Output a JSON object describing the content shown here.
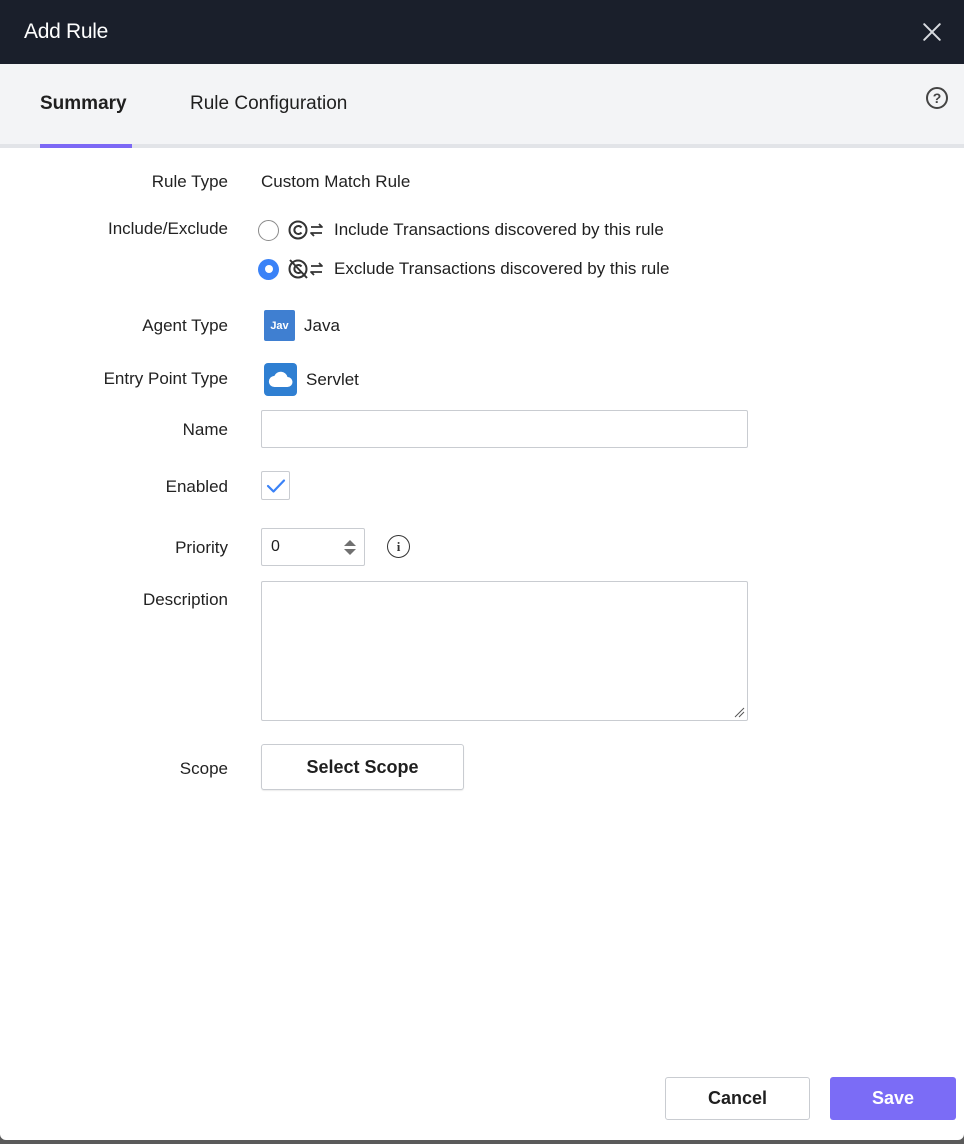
{
  "dialog": {
    "title": "Add Rule"
  },
  "tabs": [
    {
      "label": "Summary",
      "active": true
    },
    {
      "label": "Rule Configuration",
      "active": false
    }
  ],
  "help_icon_glyph": "?",
  "form": {
    "rule_type": {
      "label": "Rule Type",
      "value": "Custom Match Rule"
    },
    "include_exclude": {
      "label": "Include/Exclude",
      "options": [
        {
          "label": "Include Transactions discovered by this rule",
          "checked": false
        },
        {
          "label": "Exclude Transactions discovered by this rule",
          "checked": true
        }
      ]
    },
    "agent_type": {
      "label": "Agent Type",
      "badge": "Jav",
      "value": "Java"
    },
    "entry_point_type": {
      "label": "Entry Point Type",
      "value": "Servlet"
    },
    "name": {
      "label": "Name",
      "value": "",
      "placeholder": ""
    },
    "enabled": {
      "label": "Enabled",
      "checked": true
    },
    "priority": {
      "label": "Priority",
      "value": "0"
    },
    "info_glyph": "i",
    "description": {
      "label": "Description",
      "value": ""
    },
    "scope": {
      "label": "Scope",
      "button_label": "Select Scope"
    }
  },
  "footer": {
    "cancel_label": "Cancel",
    "save_label": "Save"
  },
  "colors": {
    "titlebar": "#1a1f2b",
    "accent": "#7b6cf6",
    "radio_checked": "#3a82f7",
    "java_badge": "#3f7fd1",
    "servlet_badge": "#2f7fd2"
  }
}
